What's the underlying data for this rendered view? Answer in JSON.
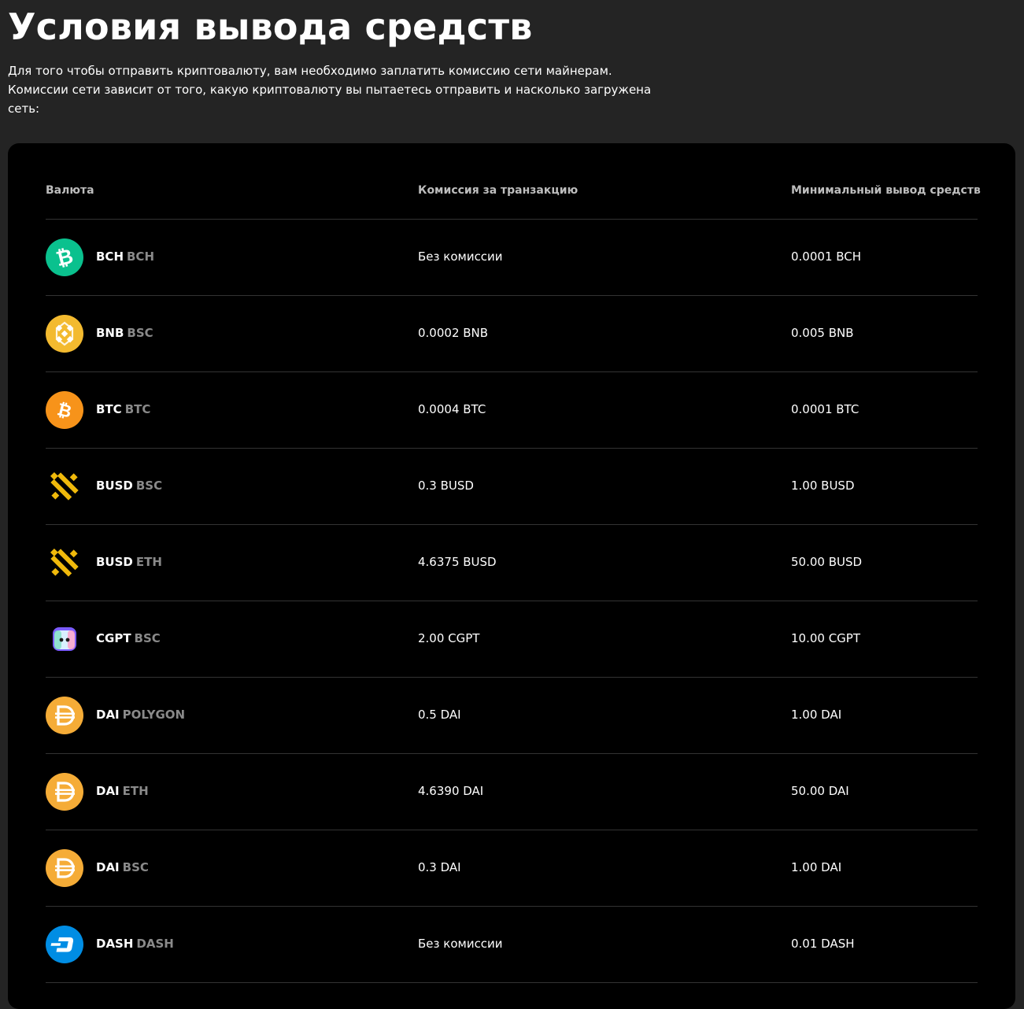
{
  "page": {
    "title": "Условия вывода средств",
    "intro": "Для того чтобы отправить криптовалюту, вам необходимо заплатить комиссию сети майнерам. Комиссии сети зависит от того, какую криптовалюту вы пытаетесь отправить и насколько загружена сеть:"
  },
  "table": {
    "headers": {
      "currency": "Валюта",
      "fee": "Комиссия за транзакцию",
      "min": "Минимальный вывод средств"
    },
    "rows": [
      {
        "symbol": "BCH",
        "network": "BCH",
        "fee": "Без комиссии",
        "min": "0.0001 BCH",
        "icon": "bitcoin-cash-icon",
        "color": "#0AC18E"
      },
      {
        "symbol": "BNB",
        "network": "BSC",
        "fee": "0.0002 BNB",
        "min": "0.005 BNB",
        "icon": "bnb-icon",
        "color": "#F3BA2F"
      },
      {
        "symbol": "BTC",
        "network": "BTC",
        "fee": "0.0004 BTC",
        "min": "0.0001 BTC",
        "icon": "bitcoin-icon",
        "color": "#F7931A"
      },
      {
        "symbol": "BUSD",
        "network": "BSC",
        "fee": "0.3 BUSD",
        "min": "1.00 BUSD",
        "icon": "busd-icon",
        "color": "#F0B90B"
      },
      {
        "symbol": "BUSD",
        "network": "ETH",
        "fee": "4.6375 BUSD",
        "min": "50.00 BUSD",
        "icon": "busd-icon",
        "color": "#F0B90B"
      },
      {
        "symbol": "CGPT",
        "network": "BSC",
        "fee": "2.00 CGPT",
        "min": "10.00 CGPT",
        "icon": "cgpt-icon",
        "color": "#7B5CFF"
      },
      {
        "symbol": "DAI",
        "network": "POLYGON",
        "fee": "0.5 DAI",
        "min": "1.00 DAI",
        "icon": "dai-icon",
        "color": "#F5AC37"
      },
      {
        "symbol": "DAI",
        "network": "ETH",
        "fee": "4.6390 DAI",
        "min": "50.00 DAI",
        "icon": "dai-icon",
        "color": "#F5AC37"
      },
      {
        "symbol": "DAI",
        "network": "BSC",
        "fee": "0.3 DAI",
        "min": "1.00 DAI",
        "icon": "dai-icon",
        "color": "#F5AC37"
      },
      {
        "symbol": "DASH",
        "network": "DASH",
        "fee": "Без комиссии",
        "min": "0.01 DASH",
        "icon": "dash-icon",
        "color": "#008DE4"
      }
    ]
  }
}
